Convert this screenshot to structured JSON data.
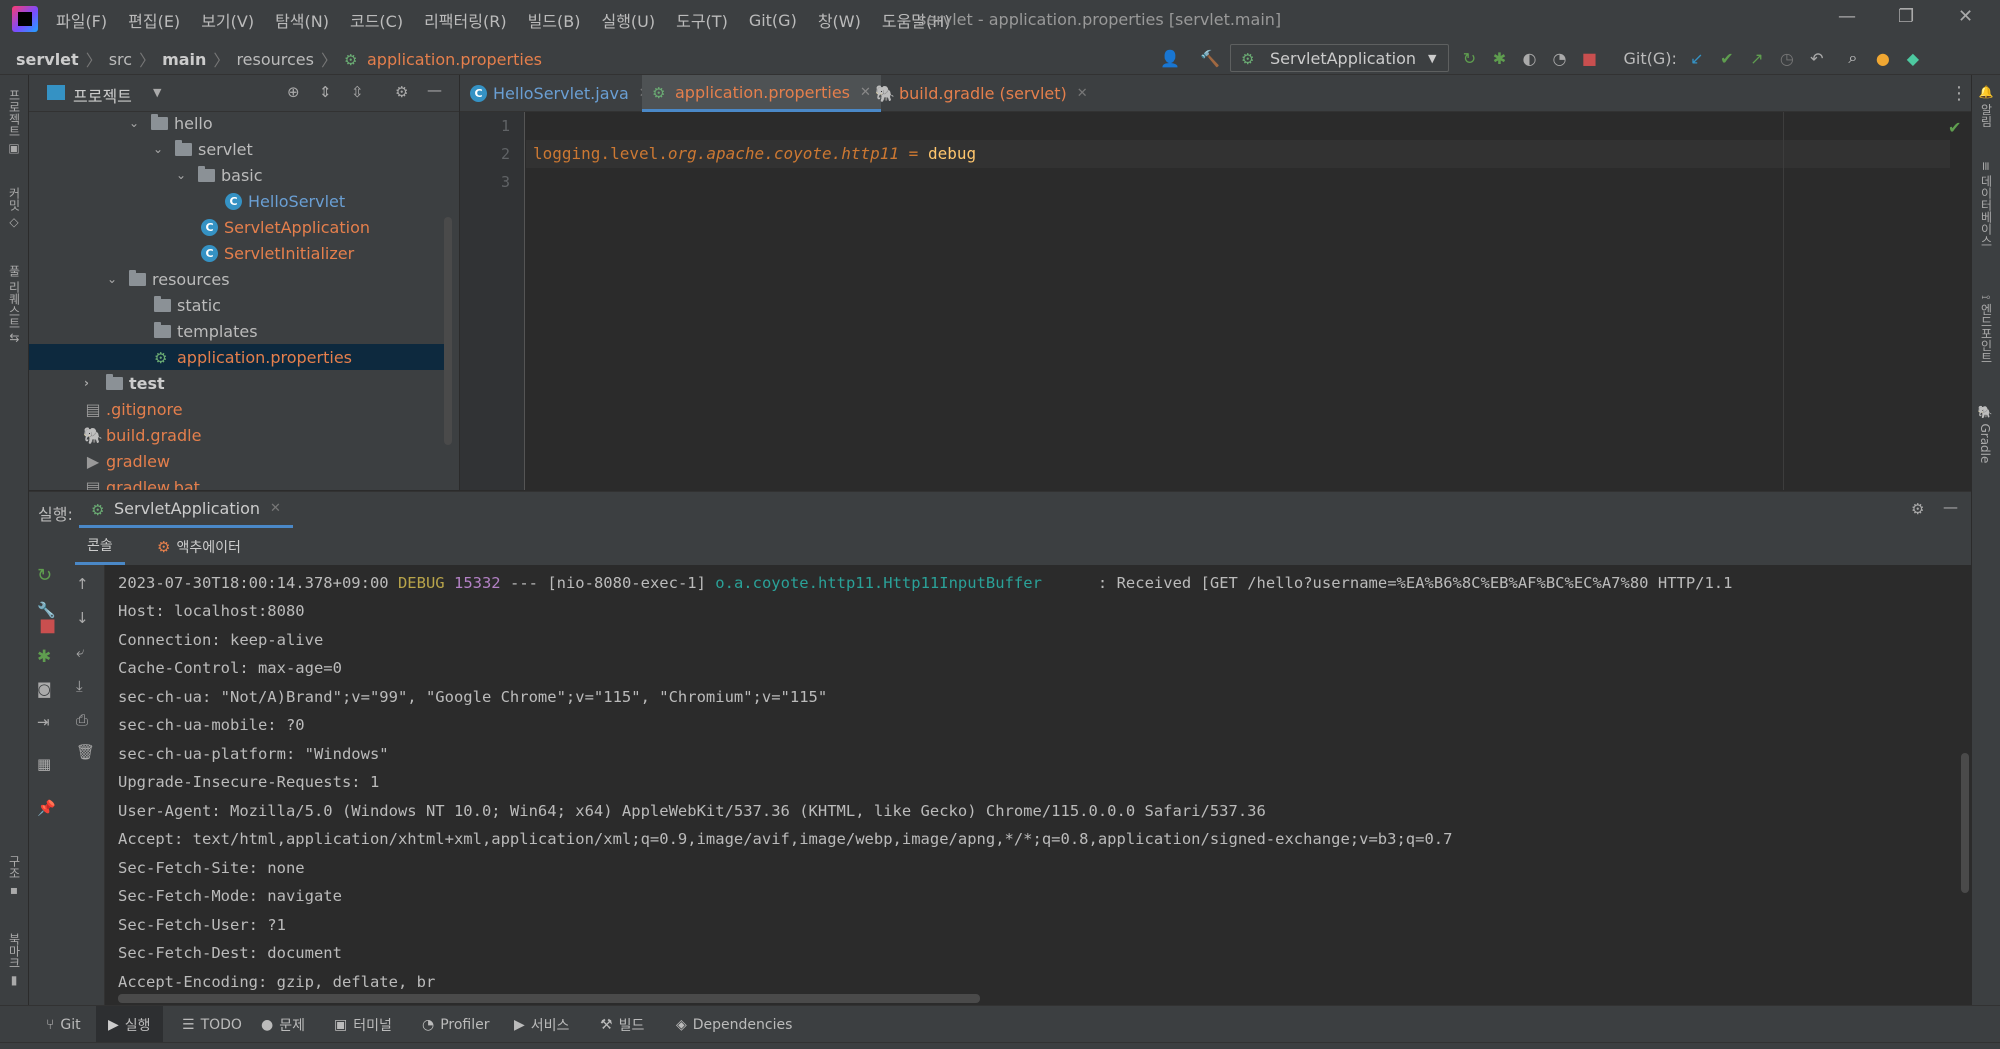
{
  "menu": [
    "파일(F)",
    "편집(E)",
    "보기(V)",
    "탐색(N)",
    "코드(C)",
    "리팩터링(R)",
    "빌드(B)",
    "실행(U)",
    "도구(T)",
    "Git(G)",
    "창(W)",
    "도움말(H)"
  ],
  "window_title": "servlet - application.properties [servlet.main]",
  "breadcrumb": [
    "servlet",
    "src",
    "main",
    "resources",
    "application.properties"
  ],
  "run_config": "ServletApplication",
  "git_label": "Git(G):",
  "project_panel": {
    "title": "프로젝트"
  },
  "tree": [
    {
      "label": "hello",
      "type": "folder",
      "expanded": true
    },
    {
      "label": "servlet",
      "type": "folder",
      "expanded": true
    },
    {
      "label": "basic",
      "type": "folder",
      "expanded": true
    },
    {
      "label": "HelloServlet",
      "type": "class"
    },
    {
      "label": "ServletApplication",
      "type": "spring-class"
    },
    {
      "label": "ServletInitializer",
      "type": "class"
    },
    {
      "label": "resources",
      "type": "folder",
      "expanded": true
    },
    {
      "label": "static",
      "type": "folder"
    },
    {
      "label": "templates",
      "type": "folder"
    },
    {
      "label": "application.properties",
      "type": "properties",
      "selected": true
    },
    {
      "label": "test",
      "type": "folder",
      "expanded": false
    },
    {
      "label": ".gitignore",
      "type": "file"
    },
    {
      "label": "build.gradle",
      "type": "gradle"
    },
    {
      "label": "gradlew",
      "type": "file"
    },
    {
      "label": "gradlew.bat",
      "type": "file"
    }
  ],
  "editor_tabs": [
    {
      "label": "HelloServlet.java",
      "active": false
    },
    {
      "label": "application.properties",
      "active": true
    },
    {
      "label": "build.gradle (servlet)",
      "active": false
    }
  ],
  "editor": {
    "line_numbers": [
      "1",
      "2",
      "3"
    ],
    "line2": {
      "key_prefix": "logging.level.",
      "key_pkg": "org.apache.coyote.http11",
      "eq": " = ",
      "value": "debug"
    }
  },
  "run_panel": {
    "label": "실행:",
    "tab": "ServletApplication",
    "subtabs": [
      "콘솔",
      "액추에이터"
    ]
  },
  "console": {
    "first": {
      "timestamp": "2023-07-30T18:00:14.378+09:00",
      "level": "DEBUG",
      "pid": "15332",
      "sep": " --- [nio-8080-exec-1] ",
      "logger": "o.a.coyote.http11.Http11InputBuffer",
      "msg": "      : Received [GET /hello?username=%EA%B6%8C%EB%AF%BC%EC%A7%80 HTTP/1.1"
    },
    "lines": [
      "Host: localhost:8080",
      "Connection: keep-alive",
      "Cache-Control: max-age=0",
      "sec-ch-ua: \"Not/A)Brand\";v=\"99\", \"Google Chrome\";v=\"115\", \"Chromium\";v=\"115\"",
      "sec-ch-ua-mobile: ?0",
      "sec-ch-ua-platform: \"Windows\"",
      "Upgrade-Insecure-Requests: 1",
      "User-Agent: Mozilla/5.0 (Windows NT 10.0; Win64; x64) AppleWebKit/537.36 (KHTML, like Gecko) Chrome/115.0.0.0 Safari/537.36",
      "Accept: text/html,application/xhtml+xml,application/xml;q=0.9,image/avif,image/webp,image/apng,*/*;q=0.8,application/signed-exchange;v=b3;q=0.7",
      "Sec-Fetch-Site: none",
      "Sec-Fetch-Mode: navigate",
      "Sec-Fetch-User: ?1",
      "Sec-Fetch-Dest: document",
      "Accept-Encoding: gzip, deflate, br"
    ]
  },
  "bottom_tabs": [
    "Git",
    "실행",
    "TODO",
    "문제",
    "터미널",
    "Profiler",
    "서비스",
    "빌드",
    "Dependencies"
  ],
  "colors": {
    "accent": "#4a88c7",
    "debug": "#b8a44a",
    "pid": "#b381c5",
    "logger": "#2aa198",
    "modified": "#e57f4c"
  }
}
